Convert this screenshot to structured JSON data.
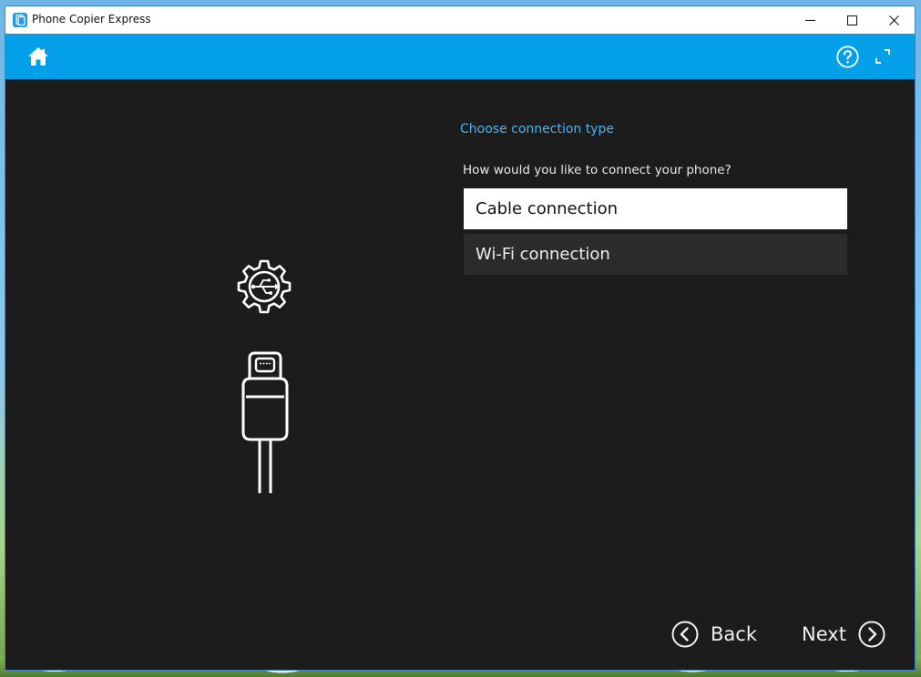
{
  "window": {
    "title": "Phone Copier Express",
    "controls": [
      "minimize",
      "maximize",
      "close"
    ]
  },
  "header": {
    "icons": [
      "home-icon",
      "help-icon",
      "fullscreen-icon"
    ]
  },
  "main": {
    "heading": "Choose connection type",
    "question": "How would you like to connect your phone?",
    "options": [
      {
        "label": "Cable connection",
        "selected": true
      },
      {
        "label": "Wi-Fi connection",
        "selected": false
      }
    ],
    "illustration": [
      "usb-gear-icon",
      "usb-cable-icon"
    ]
  },
  "footer": {
    "back_label": "Back",
    "next_label": "Next"
  },
  "colors": {
    "accent": "#03a0e9",
    "heading": "#4db3f0",
    "background": "#1c1c1c",
    "selected_option": "#ffffff",
    "unselected_option": "#2b2b2b"
  }
}
